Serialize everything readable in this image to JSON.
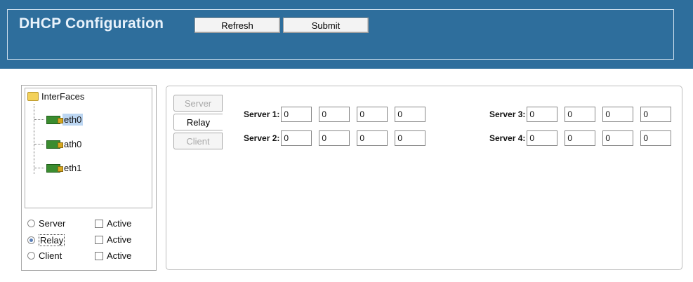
{
  "header": {
    "title": "DHCP Configuration",
    "refresh_label": "Refresh",
    "submit_label": "Submit"
  },
  "tree": {
    "root_label": "InterFaces",
    "items": [
      {
        "label": "eth0",
        "selected": true
      },
      {
        "label": "ath0",
        "selected": false
      },
      {
        "label": "eth1",
        "selected": false
      }
    ]
  },
  "modes": [
    {
      "label": "Server",
      "checked": false,
      "active_label": "Active"
    },
    {
      "label": "Relay",
      "checked": true,
      "active_label": "Active"
    },
    {
      "label": "Client",
      "checked": false,
      "active_label": "Active"
    }
  ],
  "tabs": [
    {
      "label": "Server",
      "active": false
    },
    {
      "label": "Relay",
      "active": true
    },
    {
      "label": "Client",
      "active": false
    }
  ],
  "servers": [
    {
      "label": "Server 1:",
      "octets": [
        "0",
        "0",
        "0",
        "0"
      ]
    },
    {
      "label": "Server 2:",
      "octets": [
        "0",
        "0",
        "0",
        "0"
      ]
    },
    {
      "label": "Server 3:",
      "octets": [
        "0",
        "0",
        "0",
        "0"
      ]
    },
    {
      "label": "Server 4:",
      "octets": [
        "0",
        "0",
        "0",
        "0"
      ]
    }
  ],
  "colors": {
    "header_bg": "#2e6e9c",
    "selection": "#bcd6f2"
  }
}
